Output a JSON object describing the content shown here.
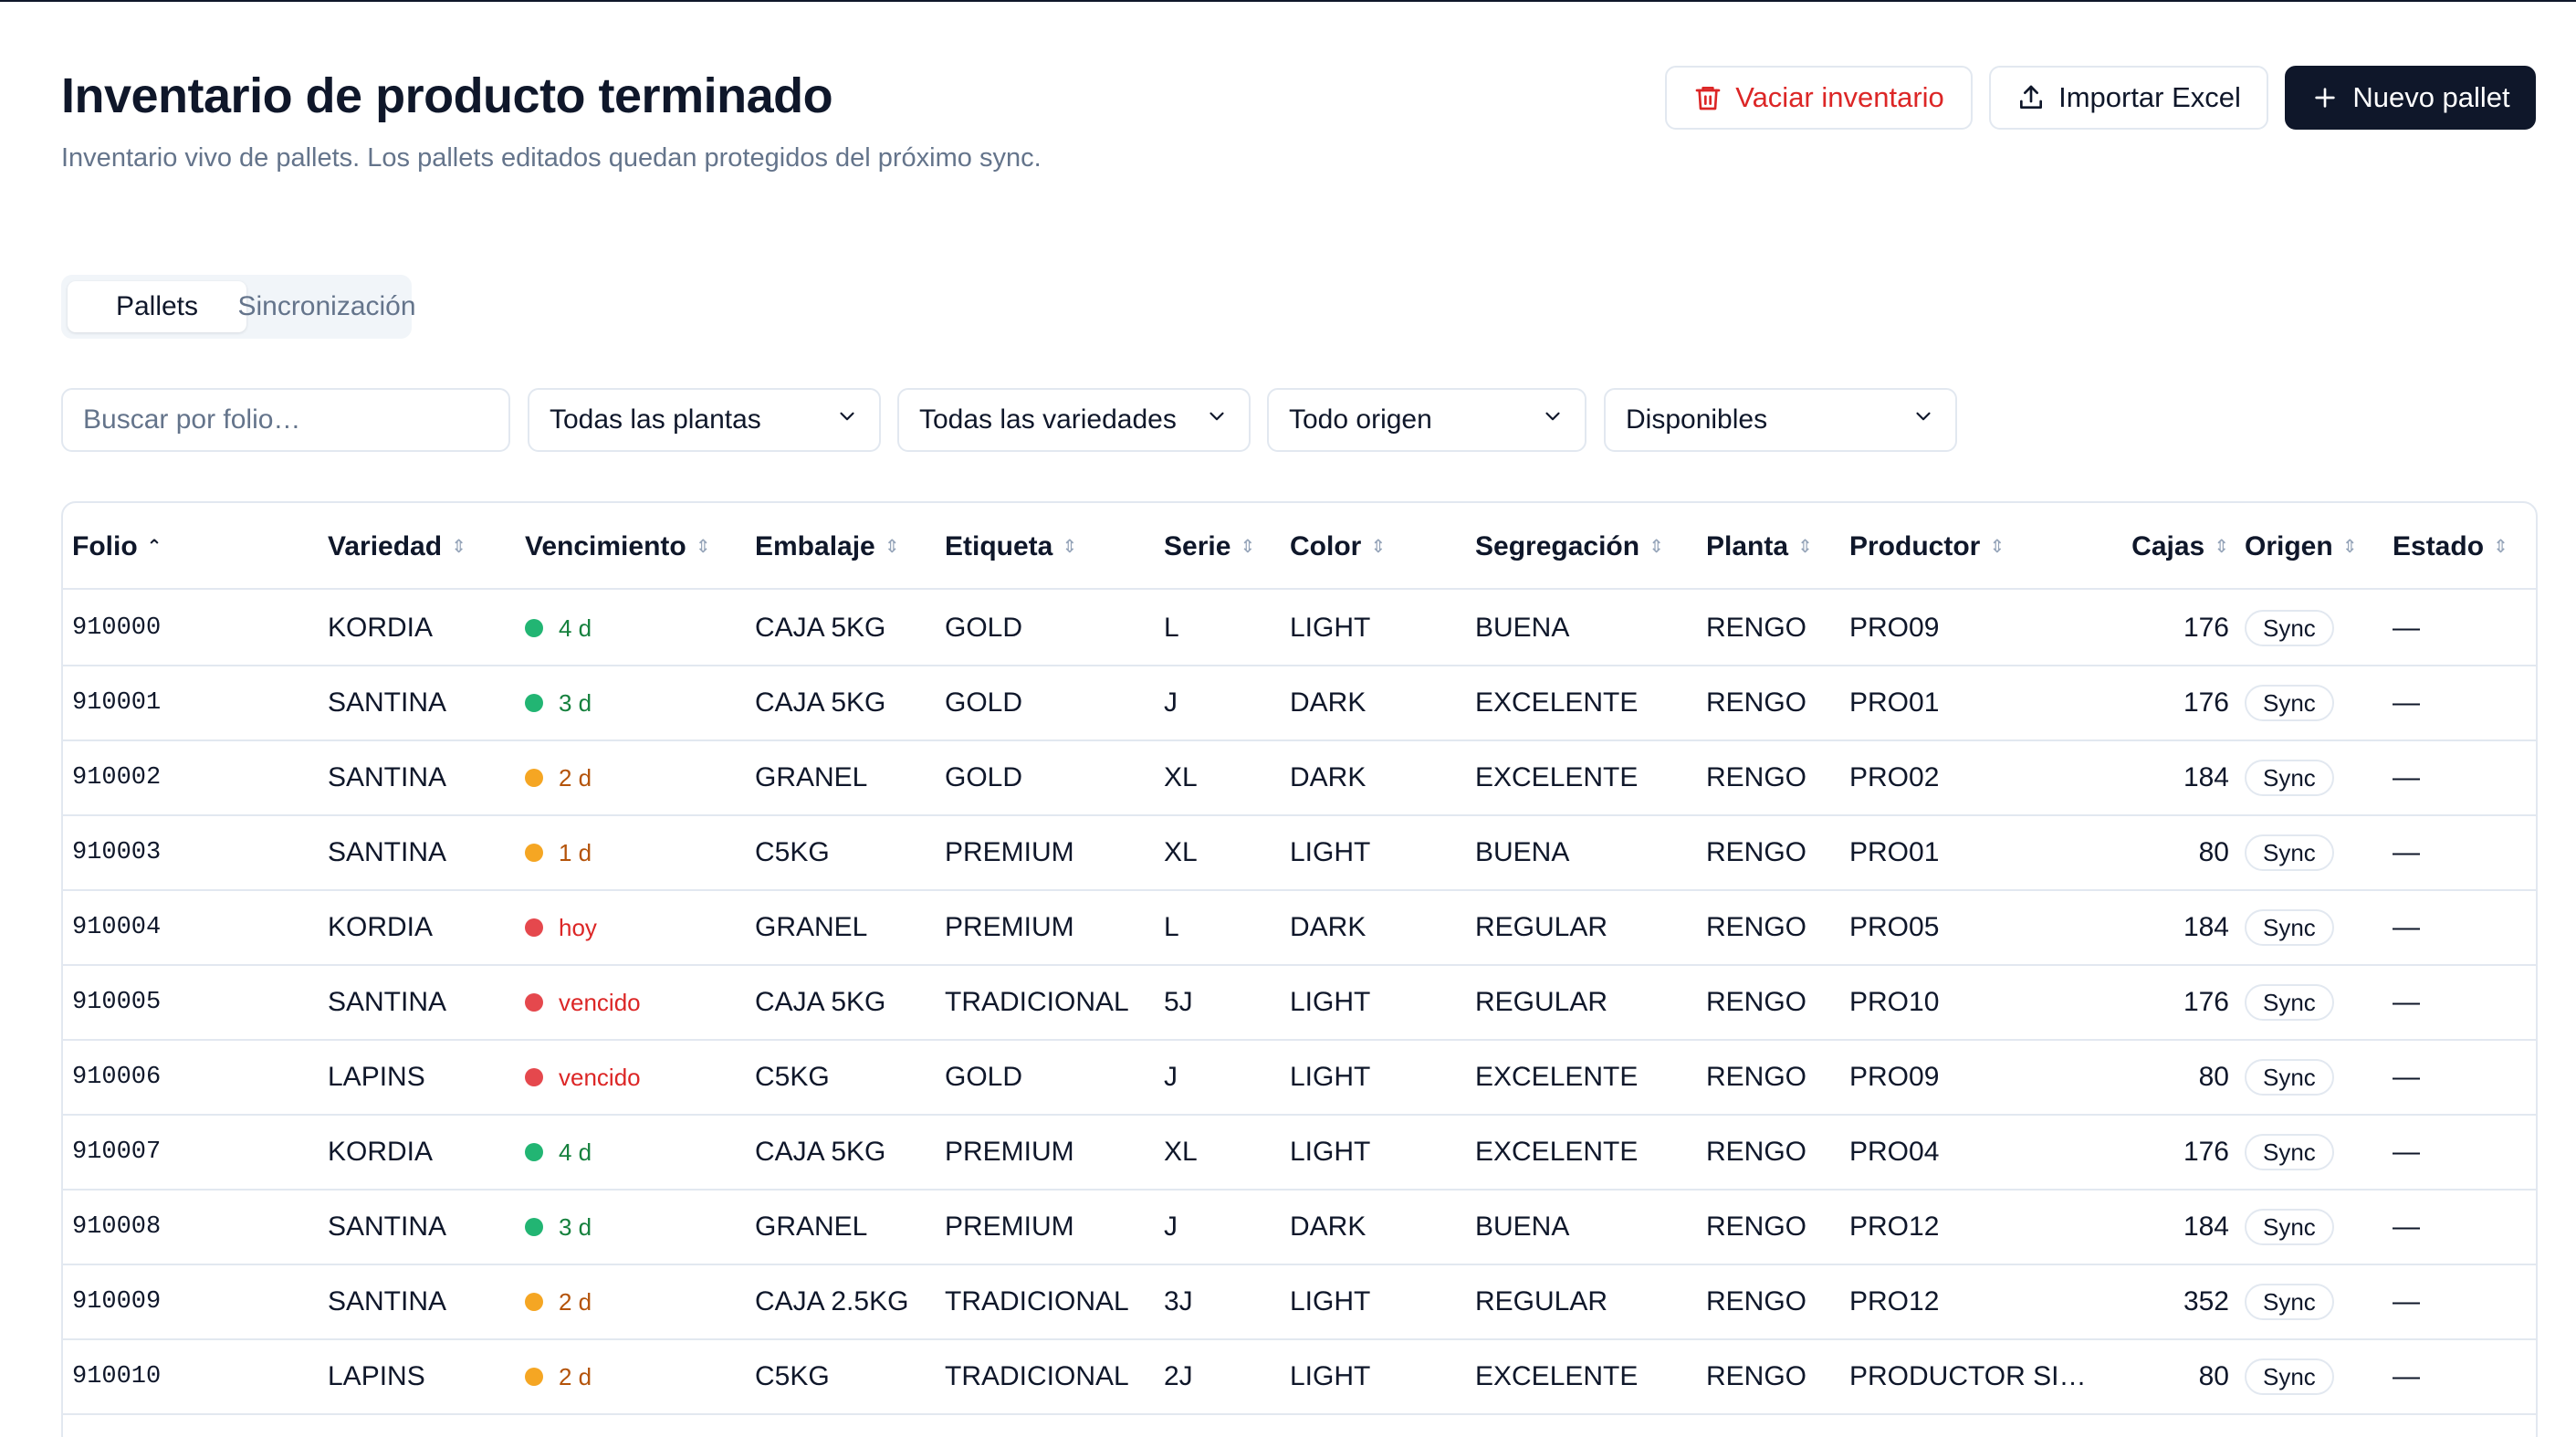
{
  "header": {
    "title": "Inventario de producto terminado",
    "subtitle": "Inventario vivo de pallets. Los pallets editados quedan protegidos del próximo sync.",
    "buttons": {
      "clear": "Vaciar inventario",
      "import": "Importar Excel",
      "new": "Nuevo pallet"
    }
  },
  "tabs": [
    {
      "label": "Pallets",
      "active": true
    },
    {
      "label": "Sincronización",
      "active": false
    }
  ],
  "filters": {
    "search_placeholder": "Buscar por folio…",
    "plants": "Todas las plantas",
    "varieties": "Todas las variedades",
    "origin": "Todo origen",
    "status": "Disponibles"
  },
  "colors": {
    "green": "#22b573",
    "amber": "#f5a623",
    "red": "#e5484d",
    "green_text": "#15803d",
    "amber_text": "#b45309",
    "red_text": "#dc2626",
    "primary": "#0f172a"
  },
  "table": {
    "columns": {
      "folio": "Folio",
      "variedad": "Variedad",
      "vencimiento": "Vencimiento",
      "embalaje": "Embalaje",
      "etiqueta": "Etiqueta",
      "serie": "Serie",
      "color": "Color",
      "segregacion": "Segregación",
      "planta": "Planta",
      "productor": "Productor",
      "cajas": "Cajas",
      "origen": "Origen",
      "estado": "Estado"
    },
    "rows": [
      {
        "folio": "910000",
        "variedad": "KORDIA",
        "vencimiento": "4 d",
        "status": "green",
        "embalaje": "CAJA 5KG",
        "etiqueta": "GOLD",
        "serie": "L",
        "color": "LIGHT",
        "segregacion": "BUENA",
        "planta": "RENGO",
        "productor": "PRO09",
        "cajas": "176",
        "origen": "Sync",
        "estado": "—"
      },
      {
        "folio": "910001",
        "variedad": "SANTINA",
        "vencimiento": "3 d",
        "status": "green",
        "embalaje": "CAJA 5KG",
        "etiqueta": "GOLD",
        "serie": "J",
        "color": "DARK",
        "segregacion": "EXCELENTE",
        "planta": "RENGO",
        "productor": "PRO01",
        "cajas": "176",
        "origen": "Sync",
        "estado": "—"
      },
      {
        "folio": "910002",
        "variedad": "SANTINA",
        "vencimiento": "2 d",
        "status": "amber",
        "embalaje": "GRANEL",
        "etiqueta": "GOLD",
        "serie": "XL",
        "color": "DARK",
        "segregacion": "EXCELENTE",
        "planta": "RENGO",
        "productor": "PRO02",
        "cajas": "184",
        "origen": "Sync",
        "estado": "—"
      },
      {
        "folio": "910003",
        "variedad": "SANTINA",
        "vencimiento": "1 d",
        "status": "amber",
        "embalaje": "C5KG",
        "etiqueta": "PREMIUM",
        "serie": "XL",
        "color": "LIGHT",
        "segregacion": "BUENA",
        "planta": "RENGO",
        "productor": "PRO01",
        "cajas": "80",
        "origen": "Sync",
        "estado": "—"
      },
      {
        "folio": "910004",
        "variedad": "KORDIA",
        "vencimiento": "hoy",
        "status": "red",
        "embalaje": "GRANEL",
        "etiqueta": "PREMIUM",
        "serie": "L",
        "color": "DARK",
        "segregacion": "REGULAR",
        "planta": "RENGO",
        "productor": "PRO05",
        "cajas": "184",
        "origen": "Sync",
        "estado": "—"
      },
      {
        "folio": "910005",
        "variedad": "SANTINA",
        "vencimiento": "vencido",
        "status": "red",
        "embalaje": "CAJA 5KG",
        "etiqueta": "TRADICIONAL",
        "serie": "5J",
        "color": "LIGHT",
        "segregacion": "REGULAR",
        "planta": "RENGO",
        "productor": "PRO10",
        "cajas": "176",
        "origen": "Sync",
        "estado": "—"
      },
      {
        "folio": "910006",
        "variedad": "LAPINS",
        "vencimiento": "vencido",
        "status": "red",
        "embalaje": "C5KG",
        "etiqueta": "GOLD",
        "serie": "J",
        "color": "LIGHT",
        "segregacion": "EXCELENTE",
        "planta": "RENGO",
        "productor": "PRO09",
        "cajas": "80",
        "origen": "Sync",
        "estado": "—"
      },
      {
        "folio": "910007",
        "variedad": "KORDIA",
        "vencimiento": "4 d",
        "status": "green",
        "embalaje": "CAJA 5KG",
        "etiqueta": "PREMIUM",
        "serie": "XL",
        "color": "LIGHT",
        "segregacion": "EXCELENTE",
        "planta": "RENGO",
        "productor": "PRO04",
        "cajas": "176",
        "origen": "Sync",
        "estado": "—"
      },
      {
        "folio": "910008",
        "variedad": "SANTINA",
        "vencimiento": "3 d",
        "status": "green",
        "embalaje": "GRANEL",
        "etiqueta": "PREMIUM",
        "serie": "J",
        "color": "DARK",
        "segregacion": "BUENA",
        "planta": "RENGO",
        "productor": "PRO12",
        "cajas": "184",
        "origen": "Sync",
        "estado": "—"
      },
      {
        "folio": "910009",
        "variedad": "SANTINA",
        "vencimiento": "2 d",
        "status": "amber",
        "embalaje": "CAJA 2.5KG",
        "etiqueta": "TRADICIONAL",
        "serie": "3J",
        "color": "LIGHT",
        "segregacion": "REGULAR",
        "planta": "RENGO",
        "productor": "PRO12",
        "cajas": "352",
        "origen": "Sync",
        "estado": "—"
      },
      {
        "folio": "910010",
        "variedad": "LAPINS",
        "vencimiento": "2 d",
        "status": "amber",
        "embalaje": "C5KG",
        "etiqueta": "TRADICIONAL",
        "serie": "2J",
        "color": "LIGHT",
        "segregacion": "EXCELENTE",
        "planta": "RENGO",
        "productor": "PRODUCTOR SI…",
        "cajas": "80",
        "origen": "Sync",
        "estado": "—"
      }
    ]
  }
}
